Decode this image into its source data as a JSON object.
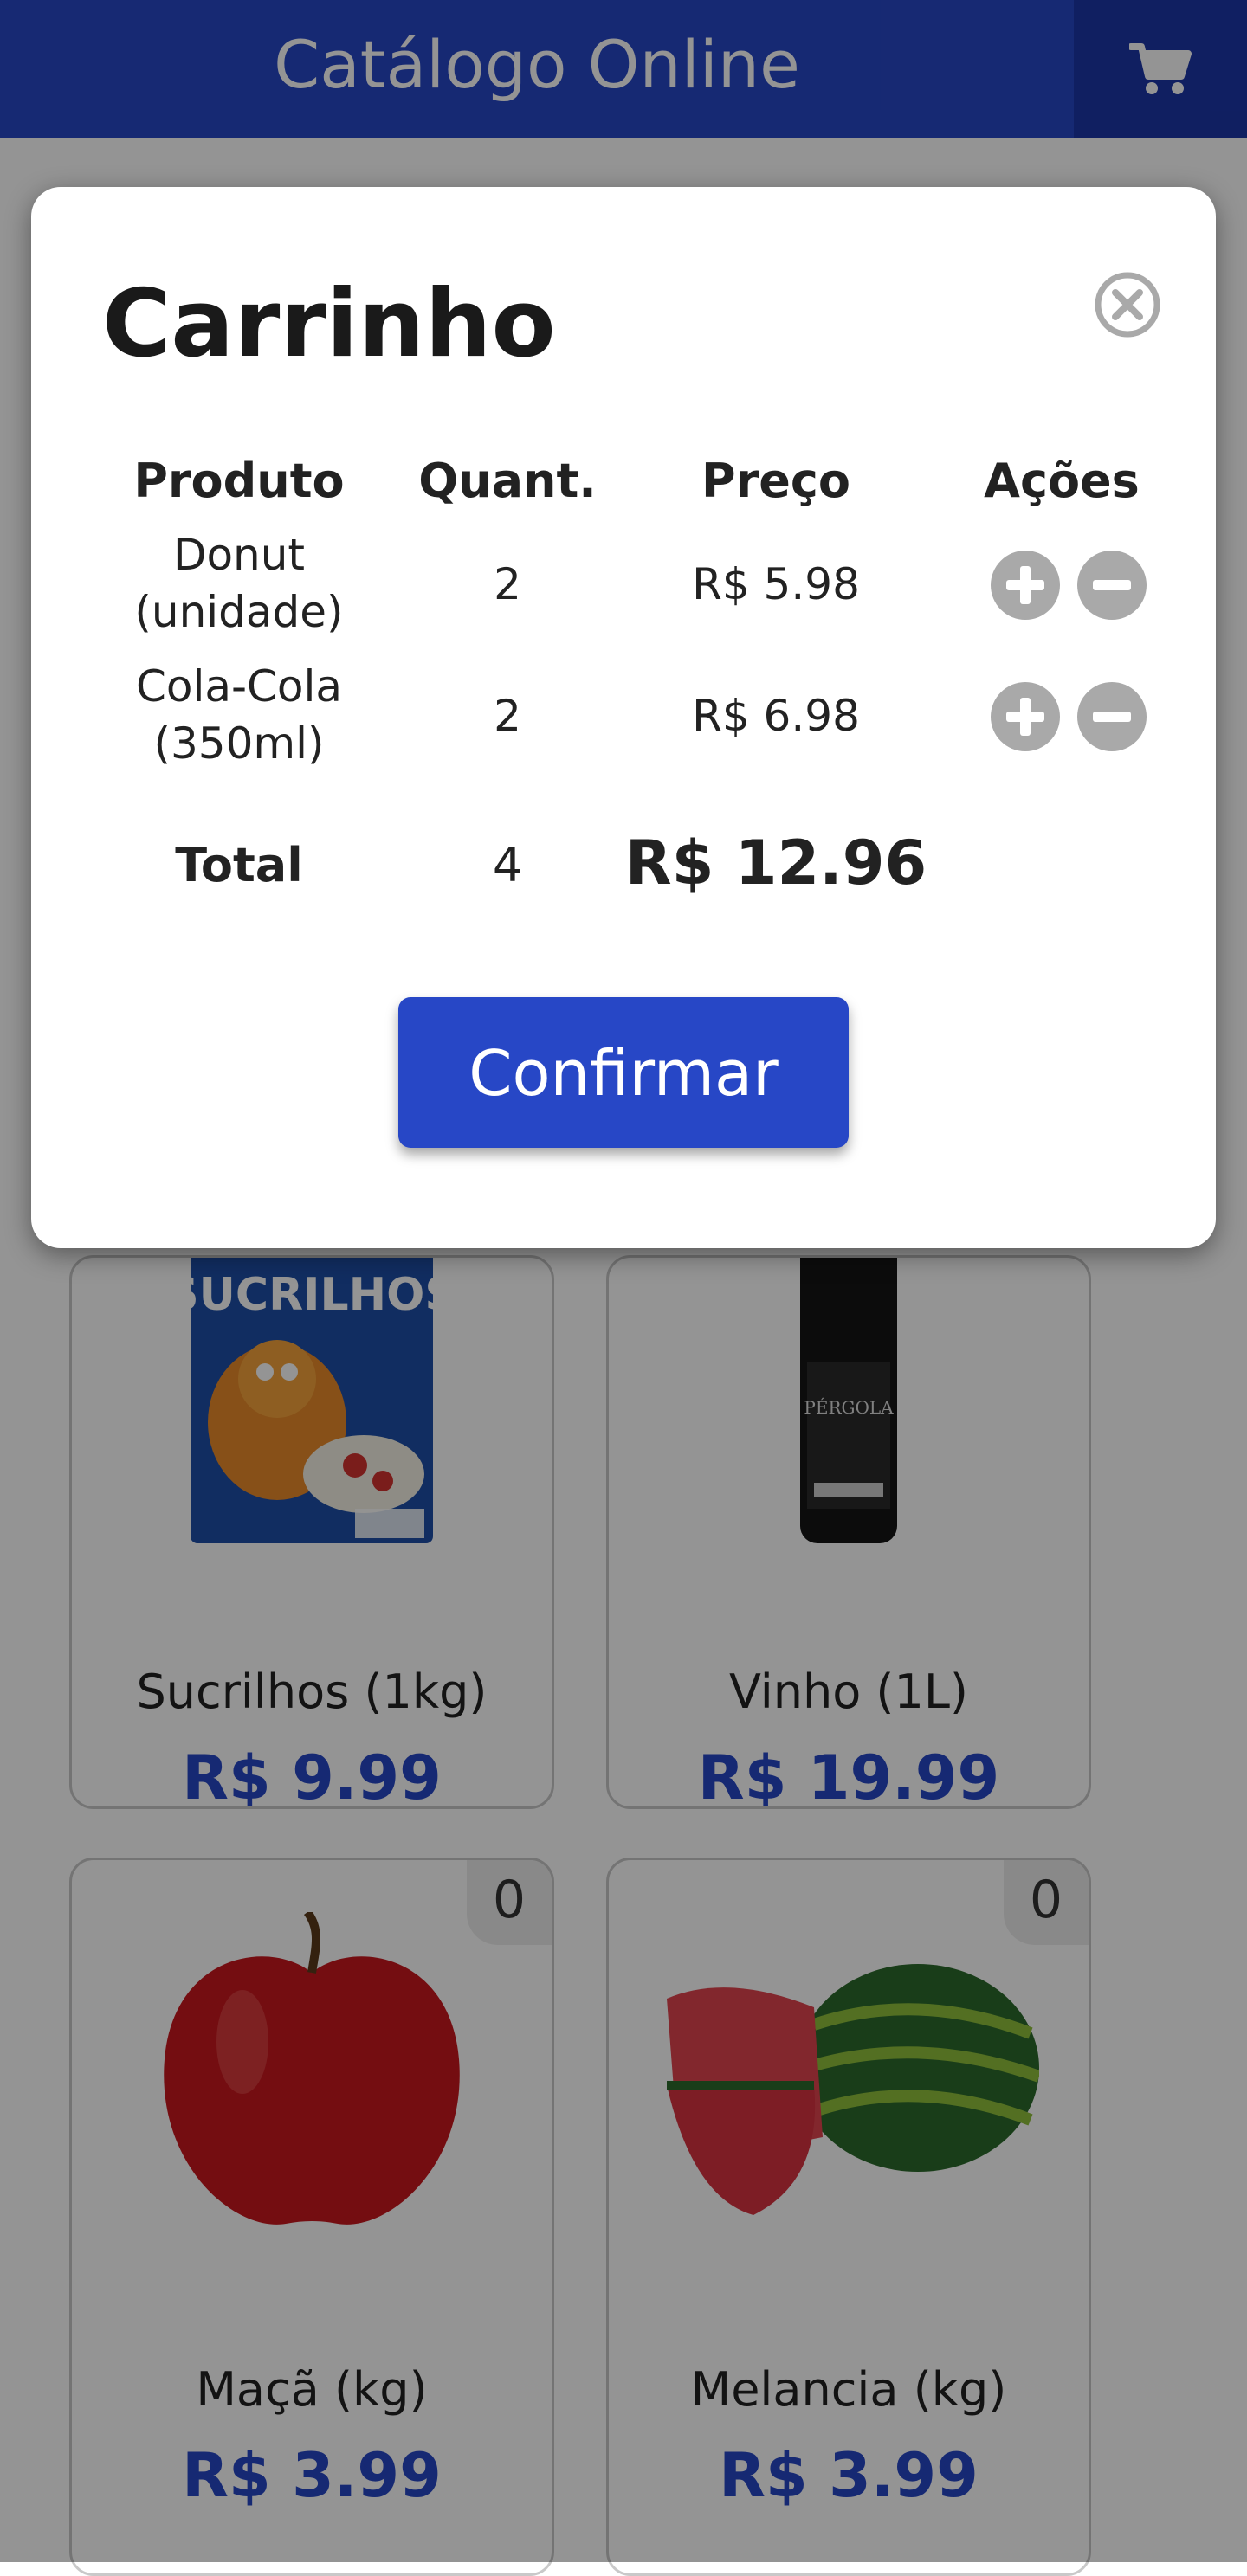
{
  "header": {
    "title": "Catálogo Online",
    "cart_icon": "shopping-cart-icon"
  },
  "products": [
    {
      "name": "Sucrilhos (1kg)",
      "price": "R$ 9.99",
      "image": "cereal-box"
    },
    {
      "name": "Vinho (1L)",
      "price": "R$ 19.99",
      "image": "wine-bottle"
    },
    {
      "name": "Maçã (kg)",
      "price": "R$ 3.99",
      "quantity": "0",
      "image": "apple"
    },
    {
      "name": "Melancia (kg)",
      "price": "R$ 3.99",
      "quantity": "0",
      "image": "watermelon"
    }
  ],
  "cart_modal": {
    "title": "Carrinho",
    "close_icon": "close-circle-icon",
    "columns": [
      "Produto",
      "Quant.",
      "Preço",
      "Ações"
    ],
    "rows": [
      {
        "product": "Donut (unidade)",
        "quantity": "2",
        "price": "R$ 5.98"
      },
      {
        "product": "Cola-Cola (350ml)",
        "quantity": "2",
        "price": "R$ 6.98"
      }
    ],
    "total": {
      "label": "Total",
      "quantity": "4",
      "price": "R$ 12.96"
    },
    "confirm_label": "Confirmar"
  },
  "colors": {
    "brand": "#2747c6",
    "brand_dark": "#1c36a8",
    "action_gray": "#a9a9a9"
  }
}
